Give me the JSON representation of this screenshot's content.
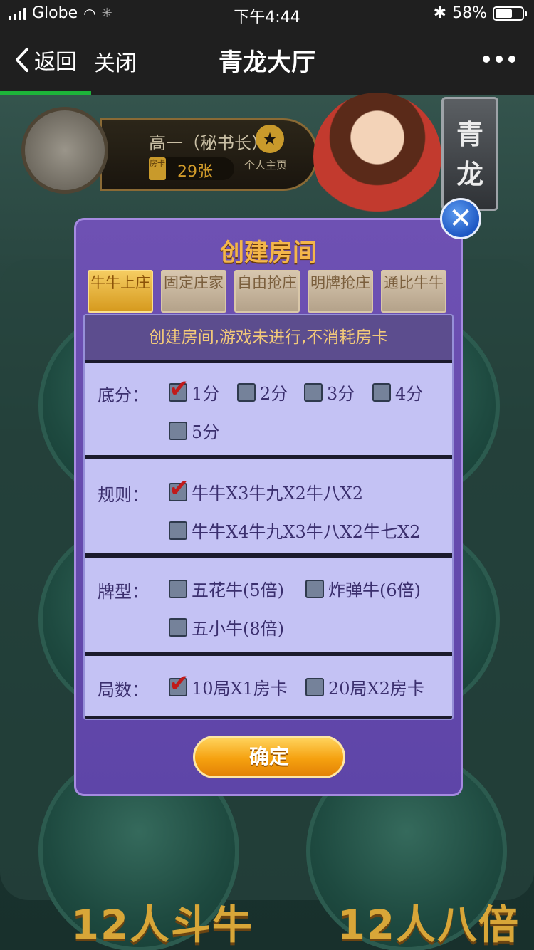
{
  "status_bar": {
    "carrier": "Globe",
    "time": "下午4:44",
    "battery": "58%"
  },
  "nav": {
    "back_label": "返回",
    "close_label": "关闭",
    "title": "青龙大厅"
  },
  "profile": {
    "name": "高一（秘书长）",
    "card_icon_text": "房卡",
    "card_count": "29张",
    "home_label": "个人主页"
  },
  "hall_tag": "青龙",
  "bg_labels": [
    "12人斗牛",
    "12人八倍"
  ],
  "modal": {
    "title": "创建房间",
    "tabs": [
      {
        "label": "牛牛上庄",
        "active": true
      },
      {
        "label": "固定庄家",
        "active": false
      },
      {
        "label": "自由抢庄",
        "active": false
      },
      {
        "label": "明牌抢庄",
        "active": false
      },
      {
        "label": "通比牛牛",
        "active": false
      }
    ],
    "notice": "创建房间,游戏未进行,不消耗房卡",
    "sections": {
      "base_score": {
        "label": "底分：",
        "options": [
          {
            "label": "1分",
            "checked": true
          },
          {
            "label": "2分",
            "checked": false
          },
          {
            "label": "3分",
            "checked": false
          },
          {
            "label": "4分",
            "checked": false
          },
          {
            "label": "5分",
            "checked": false
          }
        ]
      },
      "rules": {
        "label": "规则：",
        "options": [
          {
            "label": "牛牛X3牛九X2牛八X2",
            "checked": true
          },
          {
            "label": "牛牛X4牛九X3牛八X2牛七X2",
            "checked": false
          }
        ]
      },
      "card_types": {
        "label": "牌型：",
        "options": [
          {
            "label": "五花牛(5倍)",
            "checked": false
          },
          {
            "label": "炸弹牛(6倍)",
            "checked": false
          },
          {
            "label": "五小牛(8倍)",
            "checked": false
          }
        ]
      },
      "rounds": {
        "label": "局数：",
        "options": [
          {
            "label": "10局X1房卡",
            "checked": true
          },
          {
            "label": "20局X2房卡",
            "checked": false
          }
        ]
      }
    },
    "confirm_label": "确定"
  },
  "colors": {
    "accent_gold": "#f4b64a",
    "modal_purple": "#6e51b3",
    "progress_green": "#1db43a"
  },
  "progress": 0.17
}
